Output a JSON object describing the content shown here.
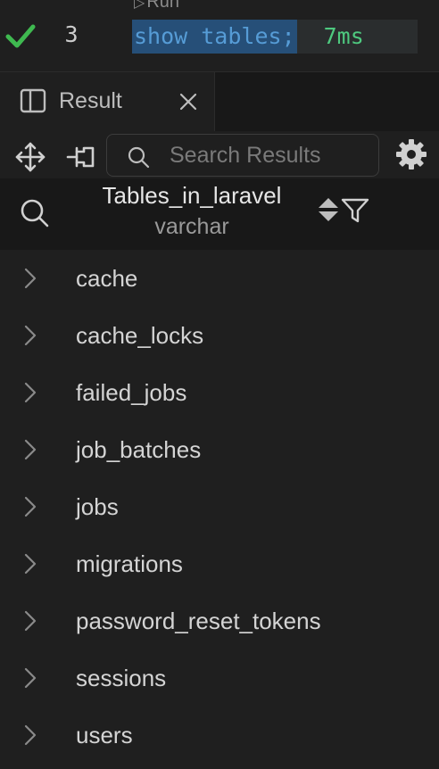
{
  "editor": {
    "codelens_run": "Run",
    "line_number": "3",
    "code": "show tables;",
    "execution_time": "7ms",
    "status_icon": "checkmark-icon",
    "colors": {
      "check": "#3fb950",
      "keyword": "#569cd6",
      "selection": "#264f78",
      "time": "#4ec97f"
    }
  },
  "tab": {
    "label": "Result",
    "icon": "panel-layout-icon",
    "close_icon": "close-icon"
  },
  "toolbar": {
    "move_icon": "move-icon",
    "pin_icon": "pin-icon",
    "search_placeholder": "Search Results",
    "settings_icon": "gear-icon"
  },
  "column": {
    "name": "Tables_in_laravel",
    "type": "varchar",
    "search_icon": "search-icon",
    "sort_icon": "sort-icon",
    "filter_icon": "filter-icon"
  },
  "rows": [
    "cache",
    "cache_locks",
    "failed_jobs",
    "job_batches",
    "jobs",
    "migrations",
    "password_reset_tokens",
    "sessions",
    "users"
  ]
}
